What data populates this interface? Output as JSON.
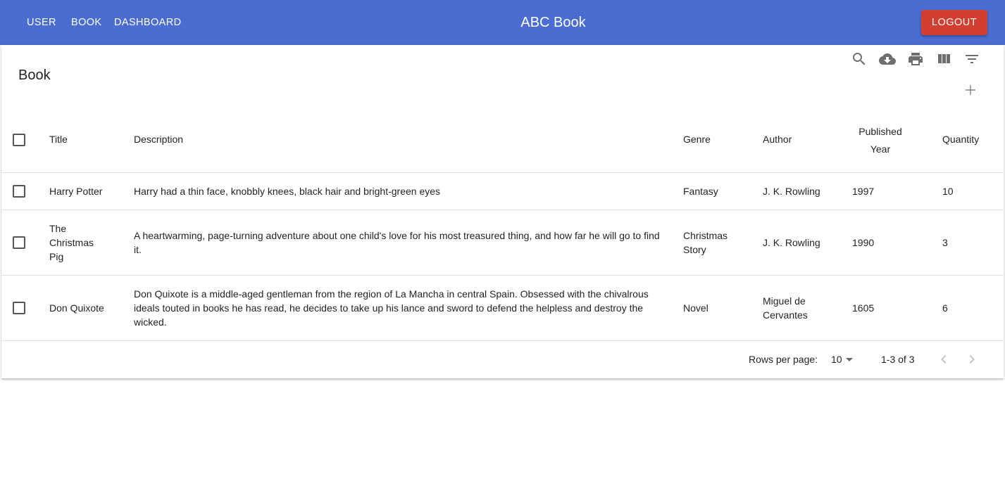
{
  "appbar": {
    "nav": [
      "USER",
      "BOOK",
      "DASHBOARD"
    ],
    "title": "ABC Book",
    "logout_label": "LOGOUT",
    "color": "#4a6dd1",
    "logout_color": "#d23f31"
  },
  "table": {
    "title": "Book",
    "toolbar_icons": [
      "search-icon",
      "download-icon",
      "print-icon",
      "view-columns-icon",
      "filter-icon",
      "add-icon"
    ],
    "columns": [
      "Title",
      "Description",
      "Genre",
      "Author",
      "Published Year",
      "Quantity"
    ],
    "rows": [
      {
        "title": "Harry Potter",
        "description": "Harry had a thin face, knobbly knees, black hair and bright-green eyes",
        "genre": "Fantasy",
        "author": "J. K. Rowling",
        "year": "1997",
        "quantity": "10"
      },
      {
        "title": "The Christmas Pig",
        "description": "A heartwarming, page-turning adventure about one child's love for his most treasured thing, and how far he will go to find it.",
        "genre": "Christmas Story",
        "author": "J. K. Rowling",
        "year": "1990",
        "quantity": "3"
      },
      {
        "title": "Don Quixote",
        "description": "Don Quixote is a middle-aged gentleman from the region of La Mancha in central Spain. Obsessed with the chivalrous ideals touted in books he has read, he decides to take up his lance and sword to defend the helpless and destroy the wicked.",
        "genre": "Novel",
        "author": "Miguel de Cervantes",
        "year": "1605",
        "quantity": "6"
      }
    ],
    "pagination": {
      "rows_per_page_label": "Rows per page:",
      "rows_per_page": "10",
      "range": "1-3 of 3"
    }
  }
}
